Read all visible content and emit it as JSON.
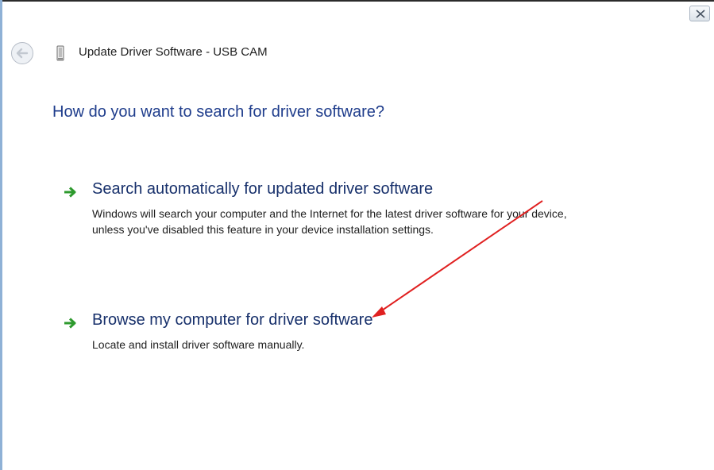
{
  "window": {
    "title": "Update Driver Software - USB CAM",
    "close_icon": "close-icon",
    "back_icon": "back-arrow-icon",
    "device_icon": "usb-device-icon"
  },
  "main": {
    "heading": "How do you want to search for driver software?"
  },
  "options": [
    {
      "icon": "green-arrow-icon",
      "title": "Search automatically for updated driver software",
      "description": "Windows will search your computer and the Internet for the latest driver software for your device, unless you've disabled this feature in your device installation settings."
    },
    {
      "icon": "green-arrow-icon",
      "title": "Browse my computer for driver software",
      "description": "Locate and install driver software manually."
    }
  ],
  "colors": {
    "heading": "#1f3d8c",
    "option_title": "#17306b",
    "arrow": "#2e9a2e",
    "annotation": "#e02020"
  }
}
